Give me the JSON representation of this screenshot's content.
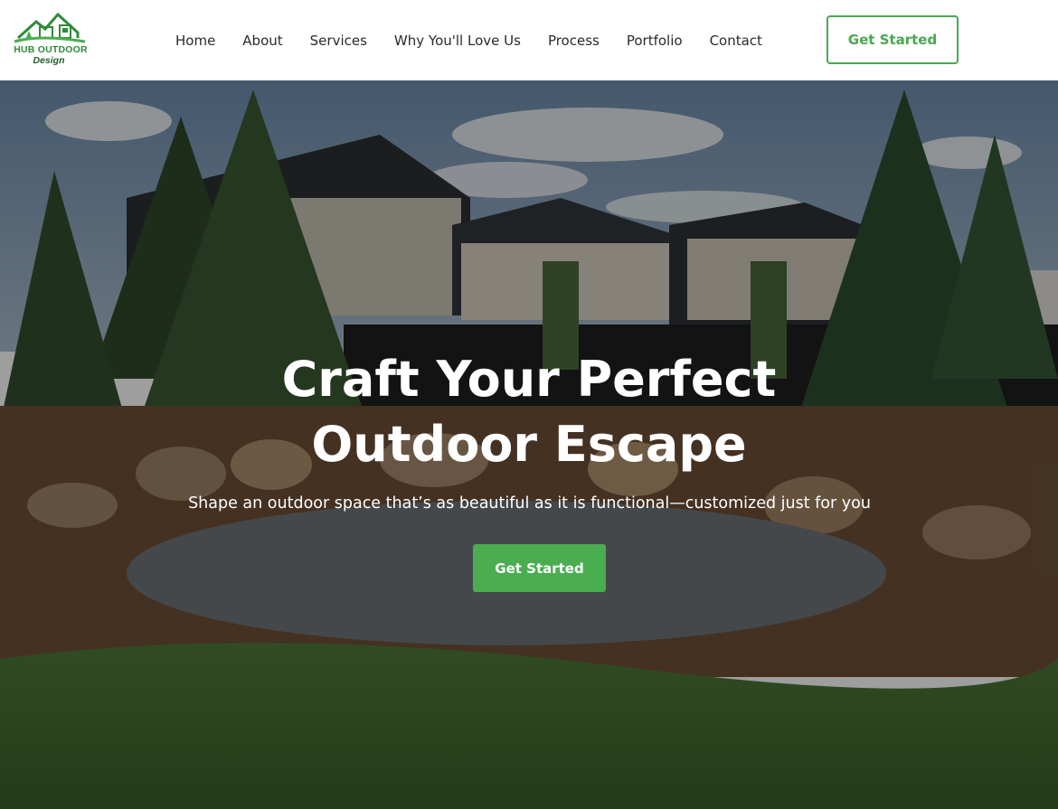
{
  "brand": {
    "name": "HUB OUTDOOR",
    "tagline": "Design"
  },
  "nav": {
    "items": [
      "Home",
      "About",
      "Services",
      "Why You'll Love Us",
      "Process",
      "Portfolio",
      "Contact"
    ]
  },
  "header_cta": "Get Started",
  "hero": {
    "title": "Craft Your Perfect Outdoor Escape",
    "subtitle": "Shape an outdoor space that’s as beautiful as it is functional—customized just for you",
    "cta": "Get Started"
  },
  "colors": {
    "accent": "#4aad50",
    "nav_text": "#2a2a2a"
  }
}
